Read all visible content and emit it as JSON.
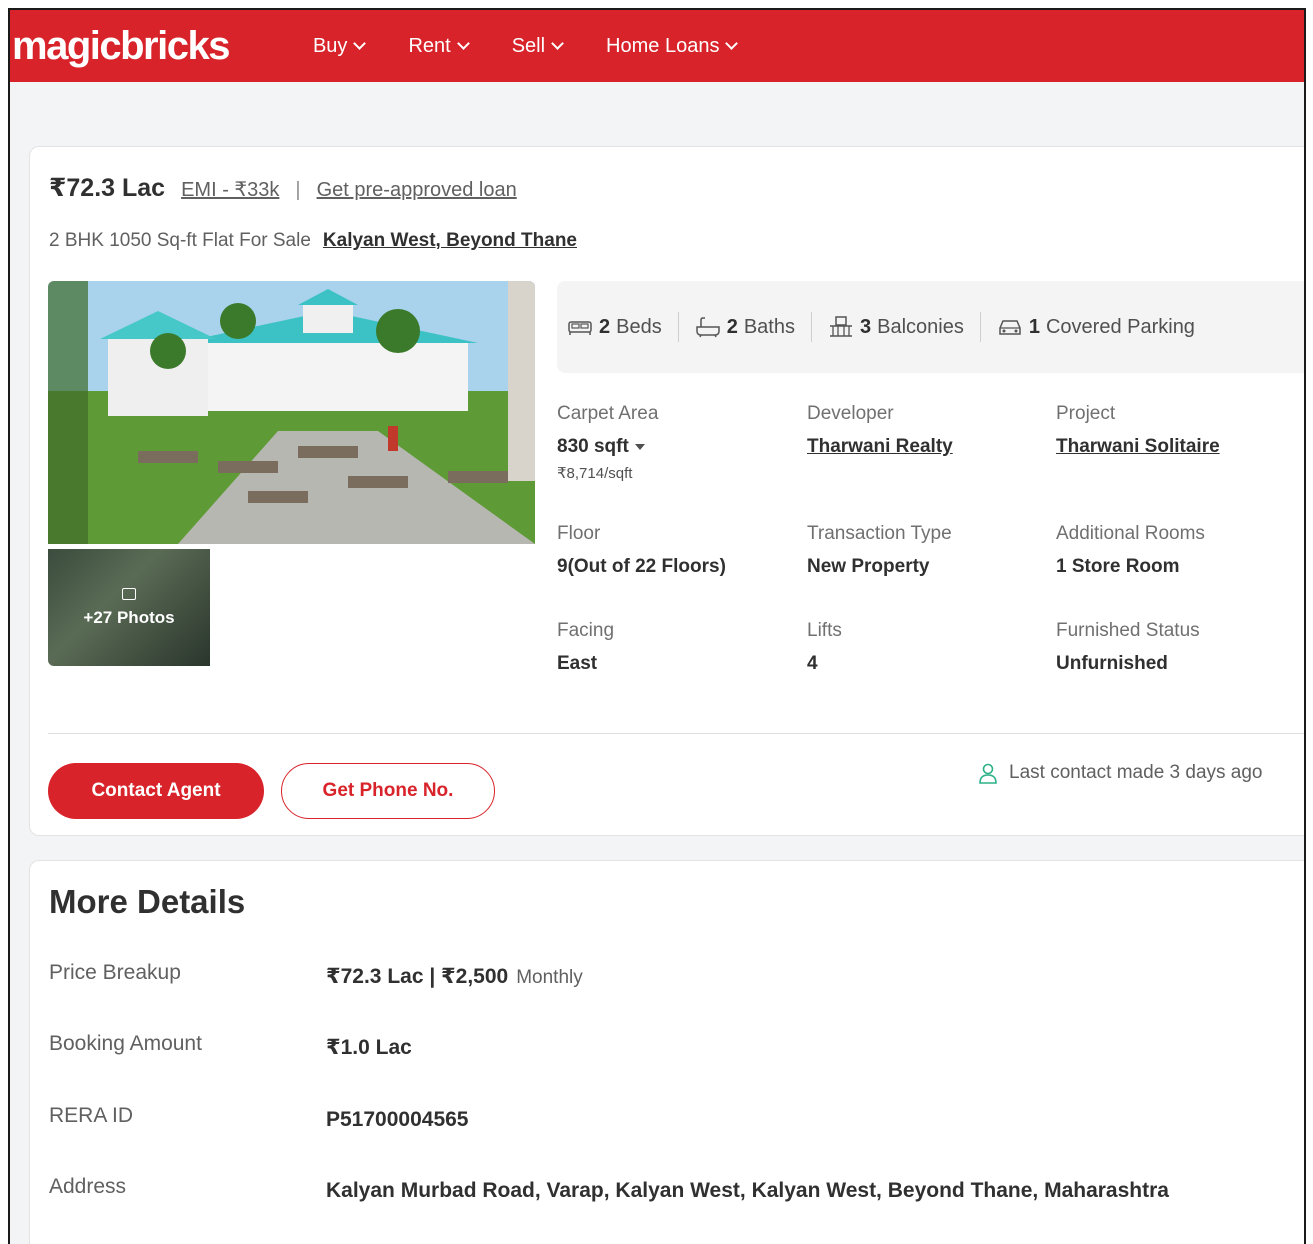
{
  "header": {
    "logo": "magicbricks",
    "nav": [
      "Buy",
      "Rent",
      "Sell",
      "Home Loans"
    ]
  },
  "listing": {
    "price": "₹72.3 Lac",
    "emi": "EMI - ₹33k",
    "separator": "|",
    "preapproved": "Get pre-approved loan",
    "title": "2 BHK 1050 Sq-ft Flat For Sale",
    "locality": "Kalyan West, Beyond Thane",
    "photos_label": "+27 Photos",
    "amenities": [
      {
        "count": "2",
        "label": "Beds",
        "icon": "bed-icon"
      },
      {
        "count": "2",
        "label": "Baths",
        "icon": "bath-icon"
      },
      {
        "count": "3",
        "label": "Balconies",
        "icon": "balcony-icon"
      },
      {
        "count": "1",
        "label": "Covered Parking",
        "icon": "car-icon"
      }
    ],
    "specs": {
      "carpet_area": {
        "label": "Carpet Area",
        "value": "830 sqft",
        "sub": "₹8,714/sqft"
      },
      "developer": {
        "label": "Developer",
        "value": "Tharwani Realty"
      },
      "project": {
        "label": "Project",
        "value": "Tharwani Solitaire"
      },
      "floor": {
        "label": "Floor",
        "value": "9(Out of 22 Floors)"
      },
      "transaction": {
        "label": "Transaction Type",
        "value": "New Property"
      },
      "additional_rooms": {
        "label": "Additional Rooms",
        "value": "1 Store Room"
      },
      "facing": {
        "label": "Facing",
        "value": "East"
      },
      "lifts": {
        "label": "Lifts",
        "value": "4"
      },
      "furnished": {
        "label": "Furnished Status",
        "value": "Unfurnished"
      }
    },
    "contact_button": "Contact Agent",
    "phone_button": "Get Phone No.",
    "last_contact": "Last contact made 3 days ago"
  },
  "more_details": {
    "title": "More Details",
    "rows": [
      {
        "label": "Price Breakup",
        "value": "₹72.3 Lac | ₹2,500",
        "suffix": "Monthly"
      },
      {
        "label": "Booking Amount",
        "value": "₹1.0 Lac"
      },
      {
        "label": "RERA ID",
        "value": "P51700004565"
      },
      {
        "label": "Address",
        "value": "Kalyan Murbad Road, Varap, Kalyan West, Kalyan West, Beyond Thane, Maharashtra"
      }
    ]
  },
  "colors": {
    "brand": "#d8232a"
  }
}
